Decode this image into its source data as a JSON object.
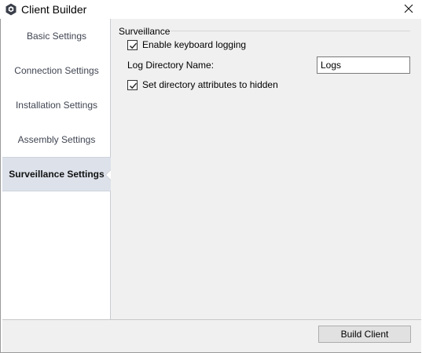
{
  "window": {
    "title": "Client Builder",
    "icon": "app-hexagon-icon",
    "close_icon": "close-icon"
  },
  "sidebar": {
    "items": [
      {
        "label": "Basic Settings",
        "active": false
      },
      {
        "label": "Connection Settings",
        "active": false
      },
      {
        "label": "Installation Settings",
        "active": false
      },
      {
        "label": "Assembly Settings",
        "active": false
      },
      {
        "label": "Surveillance Settings",
        "active": true
      }
    ]
  },
  "surveillance": {
    "group_title": "Surveillance",
    "keylog_label": "Enable keyboard logging",
    "keylog_checked": true,
    "log_dir_label": "Log Directory Name:",
    "log_dir_value": "Logs",
    "hidden_label": "Set directory attributes to hidden",
    "hidden_checked": true
  },
  "footer": {
    "build_label": "Build Client"
  },
  "colors": {
    "active_nav_bg": "#dce1ea",
    "content_bg": "#f0f0f0",
    "button_bg": "#e1e1e1"
  }
}
